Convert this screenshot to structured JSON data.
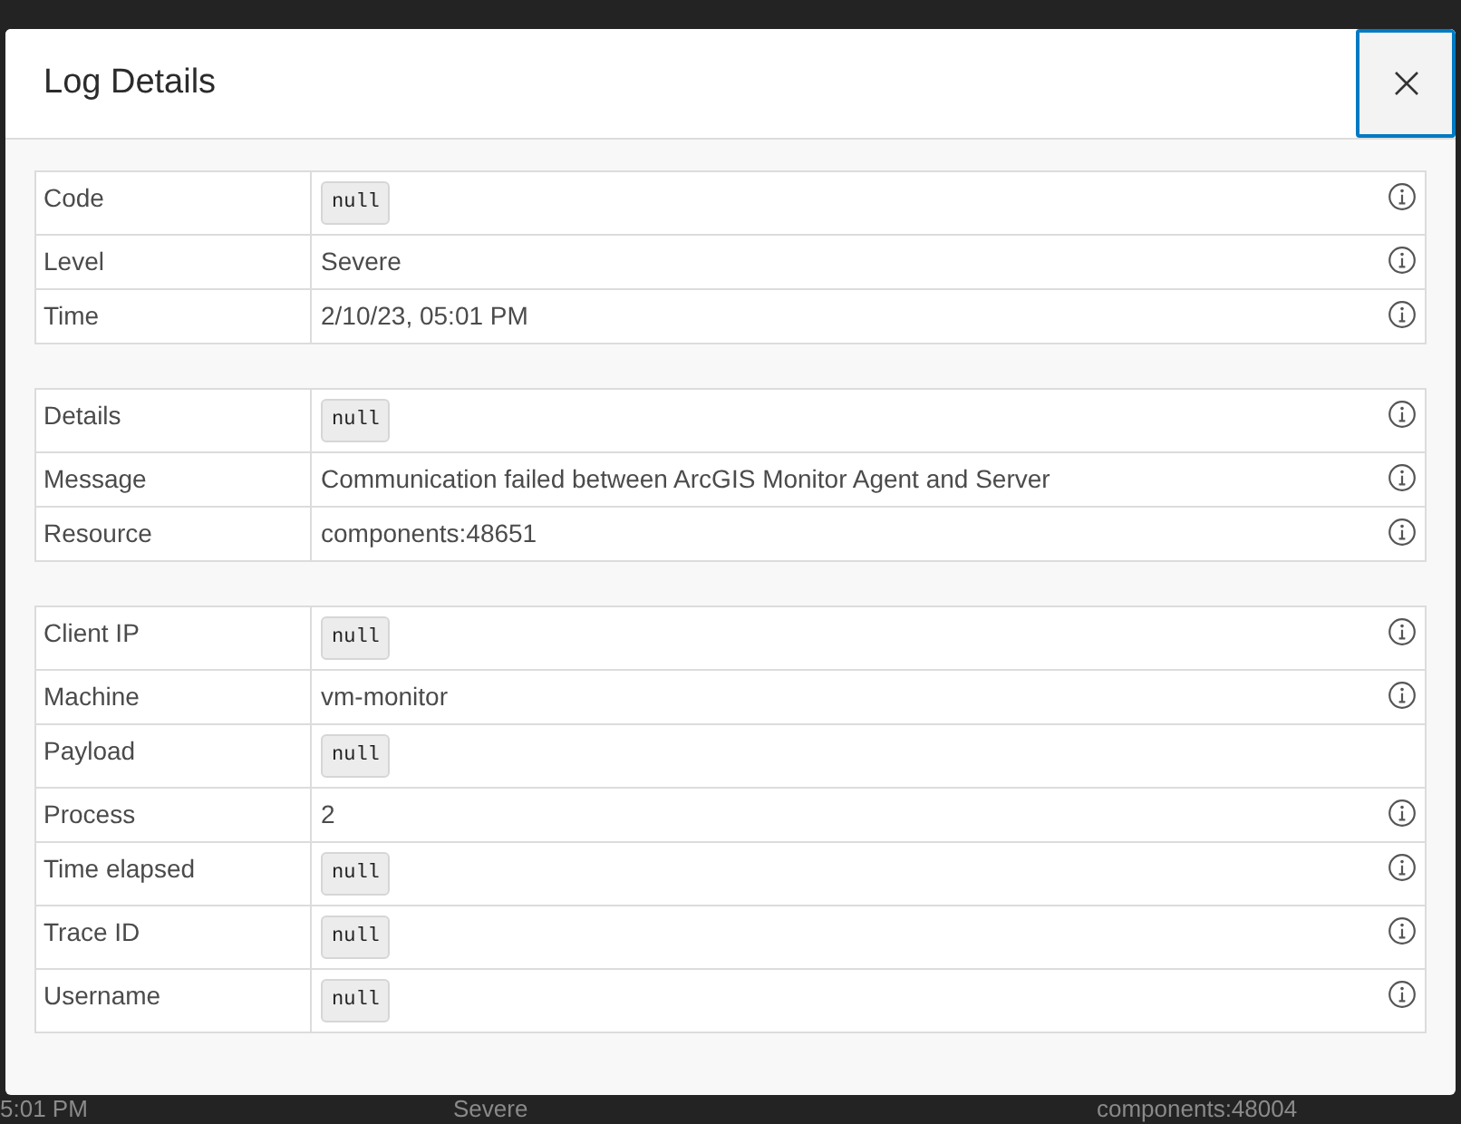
{
  "window": {
    "title": "Log Details"
  },
  "close_button": {
    "focused": true
  },
  "sections": [
    {
      "rows": [
        {
          "label": "Code",
          "kind": "code",
          "value": "null",
          "info": true
        },
        {
          "label": "Level",
          "kind": "text",
          "value": "Severe",
          "info": true
        },
        {
          "label": "Time",
          "kind": "text",
          "value": "2/10/23, 05:01 PM",
          "info": true
        }
      ]
    },
    {
      "rows": [
        {
          "label": "Details",
          "kind": "code",
          "value": "null",
          "info": true
        },
        {
          "label": "Message",
          "kind": "text",
          "value": "Communication failed between ArcGIS Monitor Agent and Server",
          "info": true
        },
        {
          "label": "Resource",
          "kind": "text",
          "value": "components:48651",
          "info": true
        }
      ]
    },
    {
      "rows": [
        {
          "label": "Client IP",
          "kind": "code",
          "value": "null",
          "info": true
        },
        {
          "label": "Machine",
          "kind": "text",
          "value": "vm-monitor",
          "info": true
        },
        {
          "label": "Payload",
          "kind": "code",
          "value": "null",
          "info": false
        },
        {
          "label": "Process",
          "kind": "text",
          "value": "2",
          "info": true
        },
        {
          "label": "Time elapsed",
          "kind": "code",
          "value": "null",
          "info": true
        },
        {
          "label": "Trace ID",
          "kind": "code",
          "value": "null",
          "info": true
        },
        {
          "label": "Username",
          "kind": "code",
          "value": "null",
          "info": true
        }
      ]
    }
  ],
  "background_row": [
    "5:01 PM",
    "Severe",
    "components:48004"
  ]
}
